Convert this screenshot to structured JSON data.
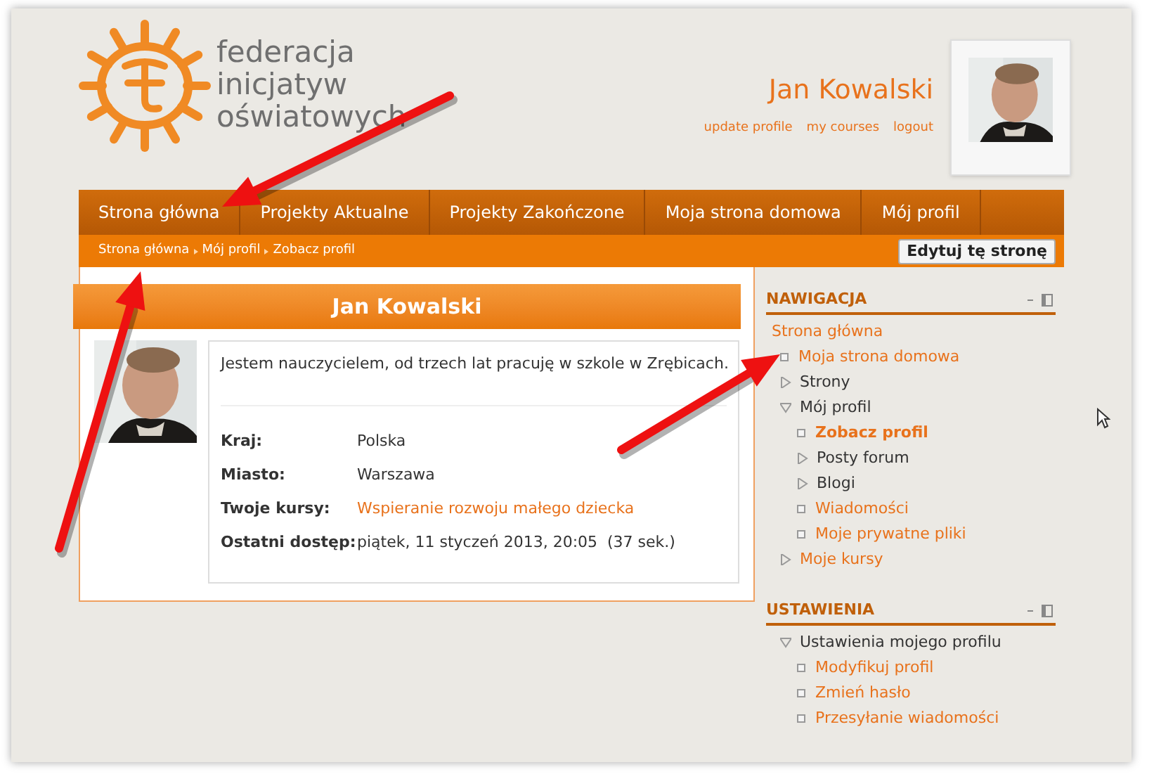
{
  "logo": {
    "lines": [
      "federacja",
      "inicjatyw",
      "oświatowych"
    ]
  },
  "user": {
    "name": "Jan Kowalski",
    "links": [
      "update profile",
      "my courses",
      "logout"
    ]
  },
  "menu": [
    "Strona główna",
    "Projekty Aktualne",
    "Projekty Zakończone",
    "Moja strona domowa",
    "Mój profil"
  ],
  "breadcrumb": [
    "Strona główna",
    "Mój profil",
    "Zobacz profil"
  ],
  "edit_button": "Edytuj tę stronę",
  "profile": {
    "title": "Jan Kowalski",
    "description": "Jestem nauczycielem, od trzech lat pracuję w szkole w Zrębicach.",
    "fields": [
      {
        "label": "Kraj:",
        "value": "Polska",
        "kind": "text"
      },
      {
        "label": "Miasto:",
        "value": "Warszawa",
        "kind": "text"
      },
      {
        "label": "Twoje kursy:",
        "value": "Wspieranie rozwoju małego dziecka",
        "kind": "link"
      },
      {
        "label": "Ostatni dostęp:",
        "value": "piątek, 11 styczeń 2013, 20:05  (37 sek.)",
        "kind": "text"
      }
    ]
  },
  "blocks": [
    {
      "title": "NAWIGACJA",
      "root": "Strona główna",
      "items": [
        {
          "label": "Moja strona domowa",
          "kind": "link",
          "selected": false
        },
        {
          "label": "Strony",
          "kind": "text",
          "expanded": false,
          "selected": false
        },
        {
          "label": "Mój profil",
          "kind": "text",
          "expanded": true,
          "selected": false,
          "children": [
            {
              "label": "Zobacz profil",
              "kind": "link",
              "selected": true
            },
            {
              "label": "Posty forum",
              "kind": "text",
              "expanded": false,
              "selected": false
            },
            {
              "label": "Blogi",
              "kind": "text",
              "expanded": false,
              "selected": false
            },
            {
              "label": "Wiadomości",
              "kind": "link",
              "selected": false
            },
            {
              "label": "Moje prywatne pliki",
              "kind": "link",
              "selected": false
            }
          ]
        },
        {
          "label": "Moje kursy",
          "kind": "link",
          "expanded": false,
          "selected": false
        }
      ]
    },
    {
      "title": "USTAWIENIA",
      "items": [
        {
          "label": "Ustawienia mojego profilu",
          "kind": "text",
          "expanded": true,
          "selected": false,
          "children": [
            {
              "label": "Modyfikuj profil",
              "kind": "link",
              "selected": false
            },
            {
              "label": "Zmień hasło",
              "kind": "link",
              "selected": false
            },
            {
              "label": "Przesyłanie wiadomości",
              "kind": "link",
              "selected": false
            }
          ]
        }
      ]
    }
  ]
}
